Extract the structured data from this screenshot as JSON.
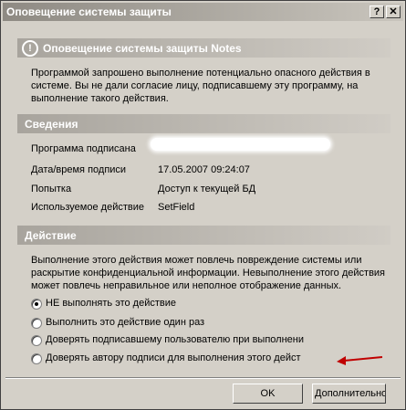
{
  "window": {
    "title": "Оповещение системы защиты",
    "help_glyph": "?",
    "close_glyph": "✕"
  },
  "banner": {
    "icon": "!",
    "title": "Оповещение системы защиты Notes",
    "message_lines": [
      "Программой запрошено выполнение потенциально опасного действия в",
      "системе. Вы не дали согласие лицу, подписавшему эту программу, на",
      "выполнение такого действия."
    ]
  },
  "details": {
    "heading": "Сведения",
    "rows": [
      {
        "label": "Программа подписана",
        "value": ""
      },
      {
        "label": "Дата/время подписи",
        "value": "17.05.2007 09:24:07"
      },
      {
        "label": "Попытка",
        "value": "Доступ к текущей БД"
      },
      {
        "label": "Используемое действие",
        "value": "SetField"
      }
    ]
  },
  "action": {
    "heading": "Действие",
    "message_lines": [
      "Выполнение этого действия может повлечь повреждение системы или",
      "раскрытие конфиденциальной информации. Невыполнение этого действия",
      "может повлечь неправильное или неполное отображение данных."
    ],
    "options": [
      {
        "label": "НЕ выполнять это действие",
        "selected": true
      },
      {
        "label": "Выполнить это действие один раз",
        "selected": false
      },
      {
        "label": "Доверять подписавшему пользователю при выполнени",
        "selected": false
      },
      {
        "label": "Доверять автору подписи для выполнения этого дейст",
        "selected": false
      }
    ]
  },
  "buttons": {
    "ok": "OK",
    "more": "Дополнительно"
  },
  "annotation_color": "#c00000"
}
